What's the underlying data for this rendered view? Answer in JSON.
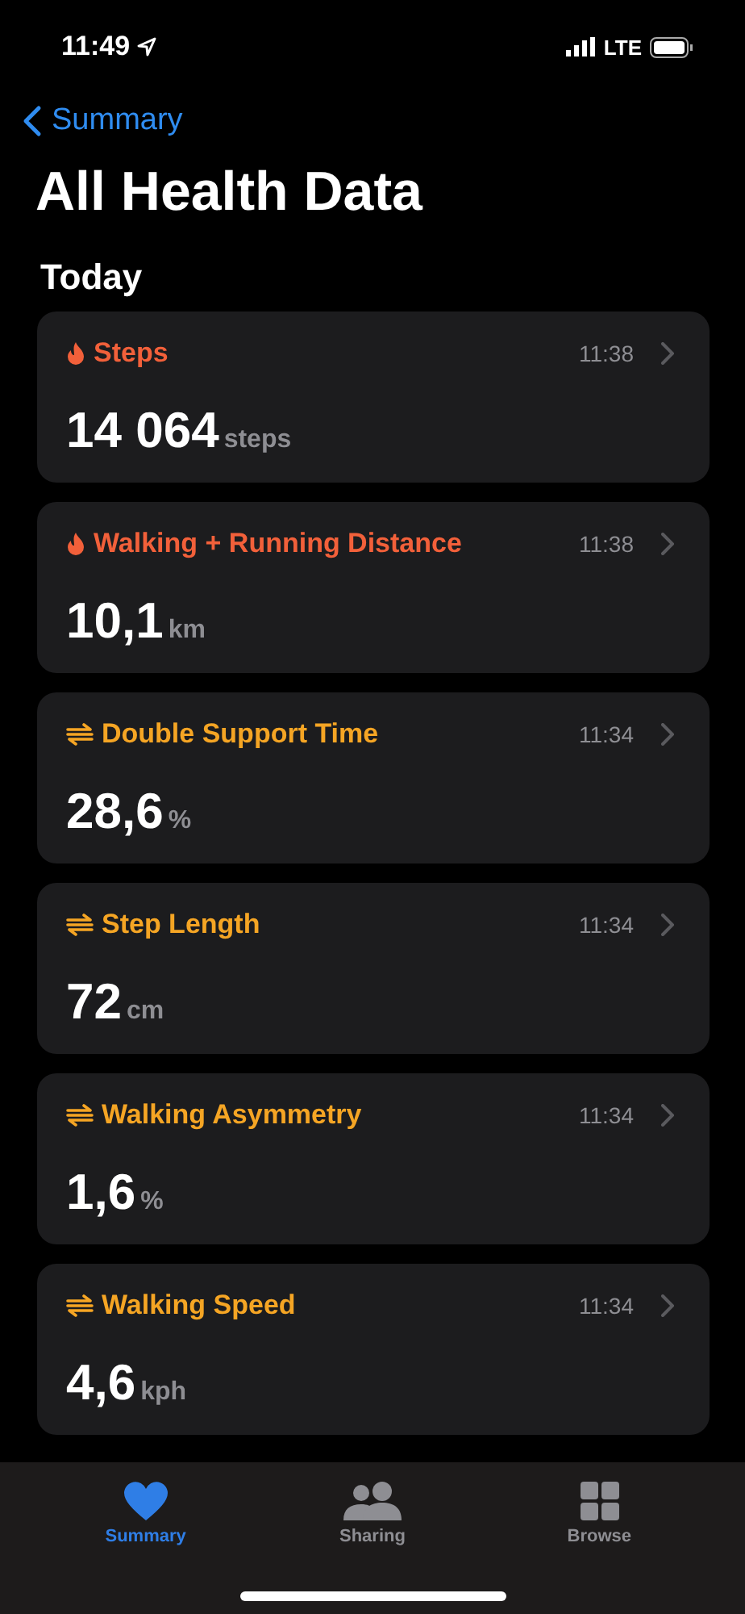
{
  "status_bar": {
    "time": "11:49",
    "network": "LTE"
  },
  "nav": {
    "back": "Summary",
    "title": "All Health Data"
  },
  "section": "Today",
  "metrics": [
    {
      "kind": "activity",
      "name": "Steps",
      "time": "11:38",
      "value": "14 064",
      "unit": "steps"
    },
    {
      "kind": "activity",
      "name": "Walking + Running Distance",
      "time": "11:38",
      "value": "10,1",
      "unit": "km"
    },
    {
      "kind": "mobility",
      "name": "Double Support Time",
      "time": "11:34",
      "value": "28,6",
      "unit": "%"
    },
    {
      "kind": "mobility",
      "name": "Step Length",
      "time": "11:34",
      "value": "72",
      "unit": "cm"
    },
    {
      "kind": "mobility",
      "name": "Walking Asymmetry",
      "time": "11:34",
      "value": "1,6",
      "unit": "%"
    },
    {
      "kind": "mobility",
      "name": "Walking Speed",
      "time": "11:34",
      "value": "4,6",
      "unit": "kph"
    }
  ],
  "tab_bar": [
    {
      "kind": "summary",
      "label": "Summary",
      "selected": true
    },
    {
      "kind": "sharing",
      "label": "Sharing",
      "selected": false
    },
    {
      "kind": "browse",
      "label": "Browse",
      "selected": false
    }
  ]
}
